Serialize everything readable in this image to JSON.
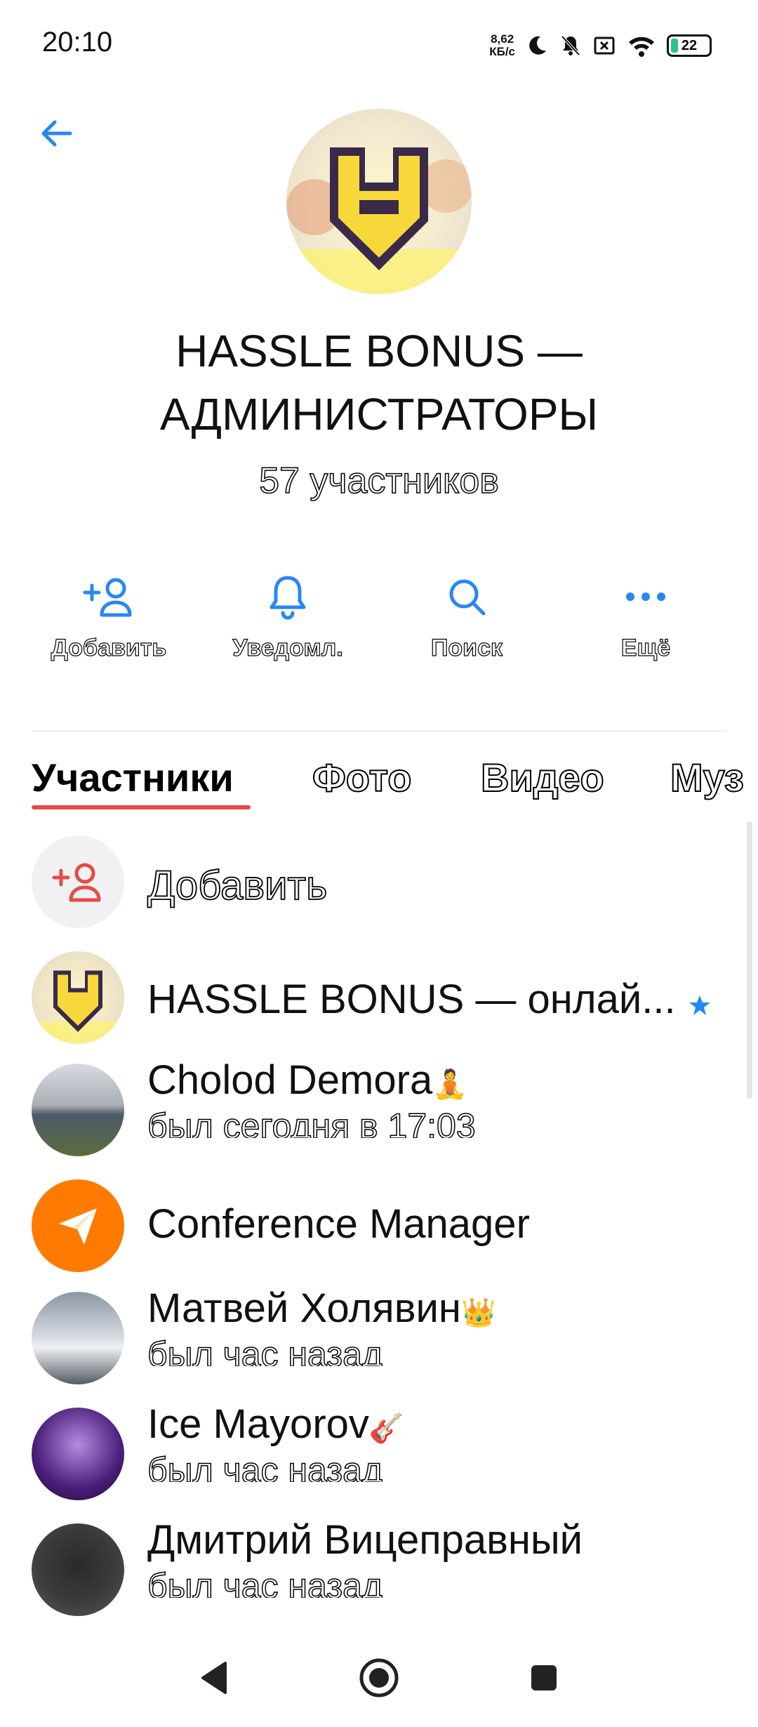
{
  "status_bar": {
    "time": "20:10",
    "net_speed_value": "8,62",
    "net_speed_unit": "КБ/с",
    "battery": "22"
  },
  "header": {
    "title": "HASSLE BONUS — АДМИНИСТРАТОРЫ",
    "members_count": "57 участников"
  },
  "actions": [
    {
      "label": "Добавить",
      "icon": "add-user-icon"
    },
    {
      "label": "Уведомл.",
      "icon": "bell-icon"
    },
    {
      "label": "Поиск",
      "icon": "search-icon"
    },
    {
      "label": "Ещё",
      "icon": "more-icon"
    }
  ],
  "tabs": [
    {
      "label": "Участники",
      "active": true
    },
    {
      "label": "Фото"
    },
    {
      "label": "Видео"
    },
    {
      "label": "Муз"
    }
  ],
  "add_member_label": "Добавить",
  "members": [
    {
      "name": "HASSLE BONUS — онлай...",
      "status": "",
      "emoji": "",
      "badge": "star-icon"
    },
    {
      "name": "Cholod Demora",
      "status": "был сегодня в 17:03",
      "emoji": "🧘"
    },
    {
      "name": "Conference Manager",
      "status": "",
      "emoji": ""
    },
    {
      "name": "Матвей Холявин",
      "status": "был час назад",
      "emoji": "👑"
    },
    {
      "name": "Ice Mayorov",
      "status": "был час назад",
      "emoji": "🎸"
    },
    {
      "name": "Дмитрий Вицеправный",
      "status": "был час назад",
      "emoji": ""
    }
  ],
  "colors": {
    "accent_blue": "#2787f5",
    "accent_red": "#e64a46",
    "conference_orange": "#ff7a00"
  }
}
